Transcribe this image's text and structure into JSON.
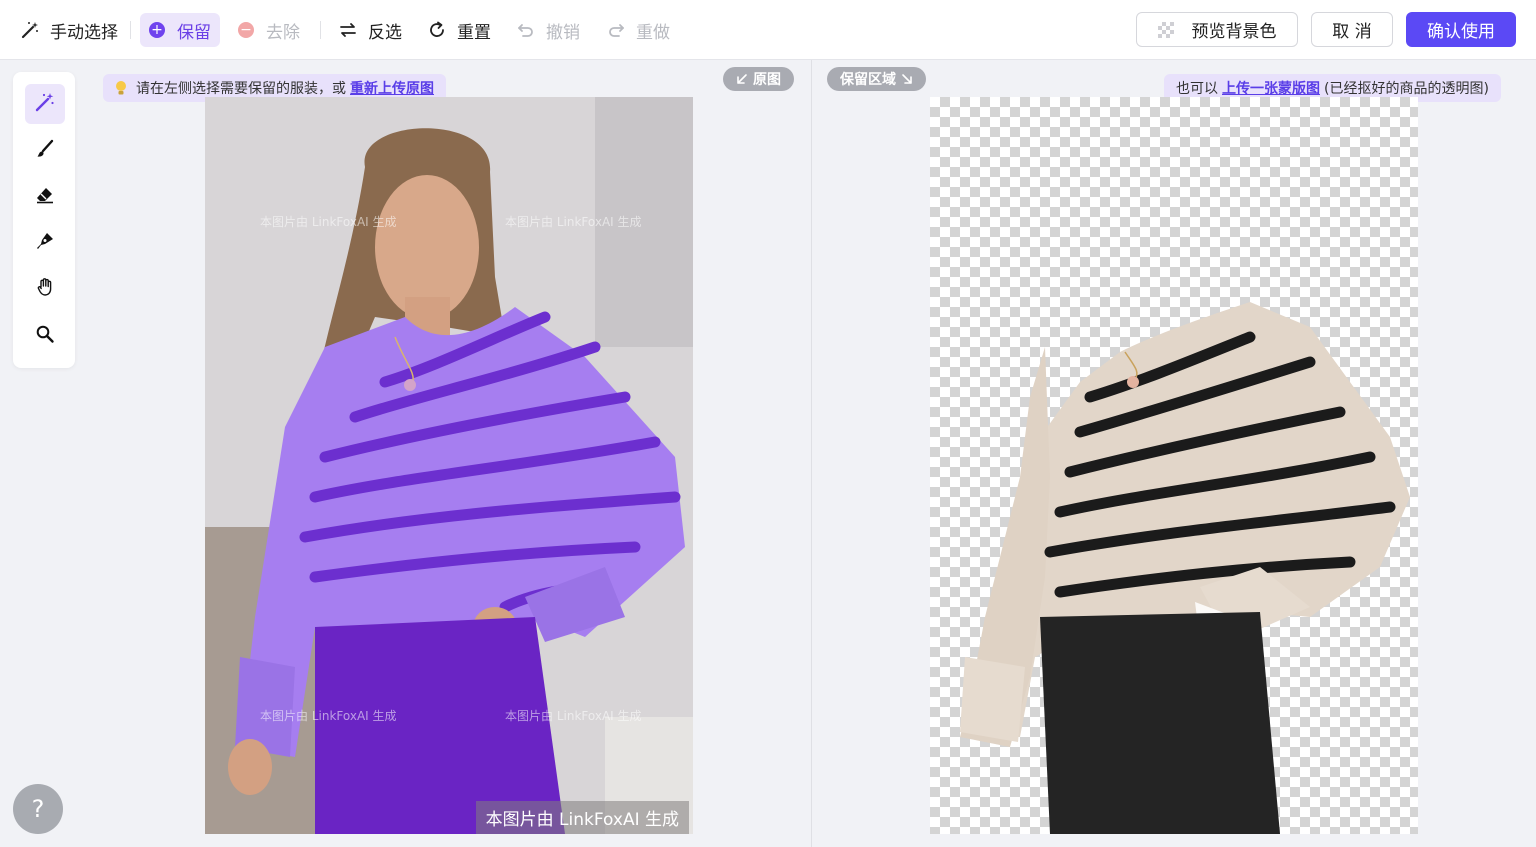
{
  "toolbar": {
    "manual_select": "手动选择",
    "keep": "保留",
    "remove": "去除",
    "invert": "反选",
    "reset": "重置",
    "undo": "撤销",
    "redo": "重做"
  },
  "actions": {
    "preview_bg": "预览背景色",
    "cancel": "取 消",
    "confirm": "确认使用"
  },
  "tools": [
    {
      "name": "magic-wand-icon"
    },
    {
      "name": "brush-icon"
    },
    {
      "name": "eraser-icon"
    },
    {
      "name": "pen-icon"
    },
    {
      "name": "hand-icon"
    },
    {
      "name": "zoom-icon"
    }
  ],
  "left_panel": {
    "hint_prefix": "请在左侧选择需要保留的服装，或",
    "hint_link": "重新上传原图",
    "pill": "原图",
    "watermark": "本图片由 LinkFoxAI 生成",
    "watermark_small": "本图片由 LinkFoxAI 生成"
  },
  "right_panel": {
    "pill": "保留区域",
    "hint_prefix": "也可以",
    "hint_link": "上传一张蒙版图",
    "hint_suffix": "(已经抠好的商品的透明图)"
  },
  "help": "?",
  "colors": {
    "accent": "#5b49f5",
    "keep_bg": "#ece6fb",
    "mask_purple": "#a67ef0",
    "mask_dark_purple": "#6c2fcf"
  }
}
